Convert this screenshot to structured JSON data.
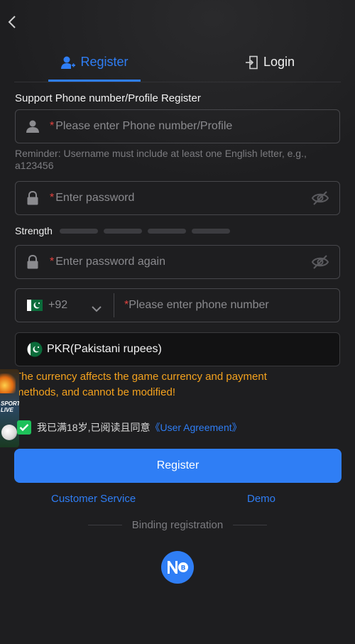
{
  "tabs": {
    "register": "Register",
    "login": "Login"
  },
  "form": {
    "section_title": "Support Phone number/Profile Register",
    "required_mark": "*",
    "username_placeholder": "Please enter Phone number/Profile",
    "reminder": "Reminder: Username must include at least one English letter, e.g., a123456",
    "password_placeholder": "Enter password",
    "strength_label": "Strength",
    "strength_level": 0,
    "confirm_placeholder": "Enter password again",
    "country_code": "+92",
    "phone_placeholder": "Please enter phone number",
    "currency": "PKR(Pakistani rupees)",
    "currency_warning": "The currency affects the game currency and payment methods, and cannot be modified!",
    "agree_text": "我已满18岁,已阅读且同意",
    "agree_link": "《User Agreement》",
    "agree_checked": true,
    "register_button": "Register"
  },
  "links": {
    "customer_service": "Customer Service",
    "demo": "Demo"
  },
  "binding": {
    "label": "Binding registration"
  },
  "side_ad": {
    "text_1": "SPORTS",
    "text_2": "LIVE"
  },
  "colors": {
    "accent": "#2f7ef5",
    "warning": "#f4a21e",
    "check": "#1ec15a",
    "required": "#e2433f"
  }
}
